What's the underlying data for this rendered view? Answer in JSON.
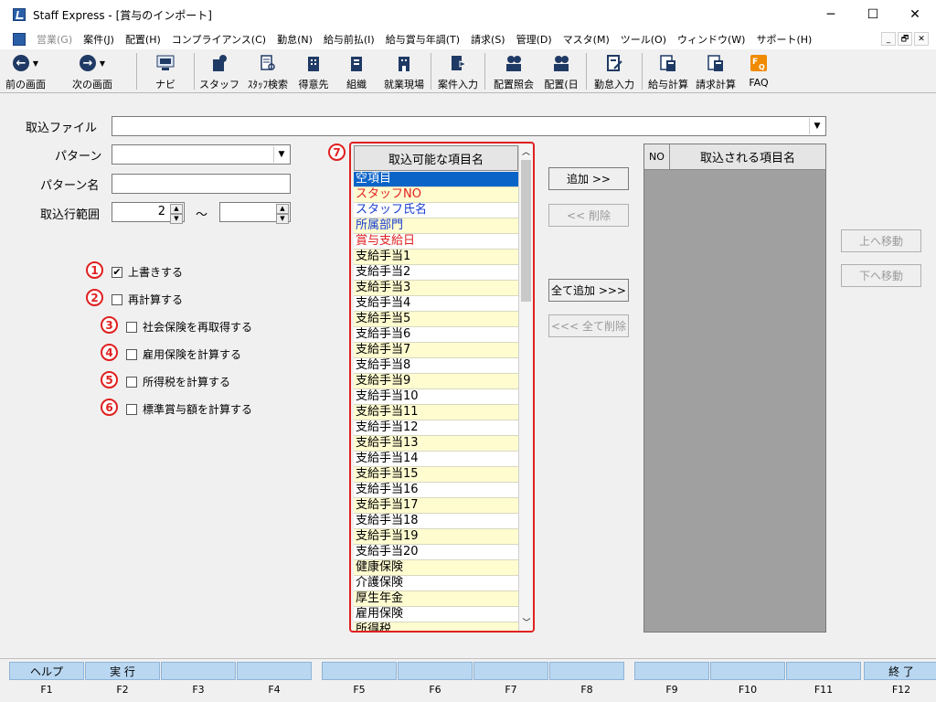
{
  "window": {
    "title": "Staff Express - [賞与のインポート]",
    "controls": [
      "─",
      "☐",
      "✕"
    ]
  },
  "menu": {
    "items": [
      {
        "label": "営業(G)",
        "disabled": true
      },
      {
        "label": "案件(J)",
        "disabled": false
      },
      {
        "label": "配置(H)",
        "disabled": false
      },
      {
        "label": "コンプライアンス(C)",
        "disabled": false
      },
      {
        "label": "勤怠(N)",
        "disabled": false
      },
      {
        "label": "給与前払(I)",
        "disabled": false
      },
      {
        "label": "給与賞与年調(T)",
        "disabled": false
      },
      {
        "label": "請求(S)",
        "disabled": false
      },
      {
        "label": "管理(D)",
        "disabled": false
      },
      {
        "label": "マスタ(M)",
        "disabled": false
      },
      {
        "label": "ツール(O)",
        "disabled": false
      },
      {
        "label": "ウィンドウ(W)",
        "disabled": false
      },
      {
        "label": "サポート(H)",
        "disabled": false
      }
    ],
    "mdi_controls": [
      "_",
      "🗗",
      "✕"
    ]
  },
  "toolbar": {
    "buttons": [
      {
        "label": "前の画面",
        "icon": "arrow-left-icon"
      },
      {
        "label": "次の画面",
        "icon": "arrow-right-icon"
      },
      {
        "label": "ナビ",
        "icon": "navi-icon"
      },
      {
        "label": "スタッフ",
        "icon": "staff-icon"
      },
      {
        "label": "ｽﾀｯﾌ検索",
        "icon": "staff-search-icon"
      },
      {
        "label": "得意先",
        "icon": "customer-icon"
      },
      {
        "label": "組織",
        "icon": "organization-icon"
      },
      {
        "label": "就業現場",
        "icon": "worksite-icon"
      },
      {
        "label": "案件入力",
        "icon": "project-entry-icon"
      },
      {
        "label": "配置照会",
        "icon": "assignment-inquiry-icon"
      },
      {
        "label": "配置(日",
        "icon": "assignment-daily-icon"
      },
      {
        "label": "勤怠入力",
        "icon": "attendance-entry-icon"
      },
      {
        "label": "給与計算",
        "icon": "payroll-calc-icon"
      },
      {
        "label": "請求計算",
        "icon": "billing-calc-icon"
      },
      {
        "label": "FAQ",
        "icon": "faq-icon"
      }
    ]
  },
  "form": {
    "import_file_label": "取込ファイル",
    "import_file_value": "",
    "pattern_label": "パターン",
    "pattern_value": "",
    "pattern_name_label": "パターン名",
    "pattern_name_value": "",
    "range_label": "取込行範囲",
    "range_from": "2",
    "range_tilde": "～",
    "range_to": ""
  },
  "options": [
    {
      "num": "1",
      "label": "上書きする",
      "checked": true
    },
    {
      "num": "2",
      "label": "再計算する",
      "checked": false
    },
    {
      "num": "3",
      "label": "社会保険を再取得する",
      "checked": false
    },
    {
      "num": "4",
      "label": "雇用保険を計算する",
      "checked": false
    },
    {
      "num": "5",
      "label": "所得税を計算する",
      "checked": false
    },
    {
      "num": "6",
      "label": "標準賞与額を計算する",
      "checked": false
    }
  ],
  "available": {
    "badge": "7",
    "header": "取込可能な項目名",
    "items": [
      {
        "text": "空項目",
        "color": "#ffffff",
        "bg": "selected"
      },
      {
        "text": "スタッフNO",
        "color": "#e02020",
        "bg": "yellow"
      },
      {
        "text": "スタッフ氏名",
        "color": "#1a3fcf",
        "bg": "white"
      },
      {
        "text": "所属部門",
        "color": "#1a3fcf",
        "bg": "yellow"
      },
      {
        "text": "賞与支給日",
        "color": "#e02020",
        "bg": "white"
      },
      {
        "text": "支給手当1",
        "color": "#000000",
        "bg": "yellow"
      },
      {
        "text": "支給手当2",
        "color": "#000000",
        "bg": "white"
      },
      {
        "text": "支給手当3",
        "color": "#000000",
        "bg": "yellow"
      },
      {
        "text": "支給手当4",
        "color": "#000000",
        "bg": "white"
      },
      {
        "text": "支給手当5",
        "color": "#000000",
        "bg": "yellow"
      },
      {
        "text": "支給手当6",
        "color": "#000000",
        "bg": "white"
      },
      {
        "text": "支給手当7",
        "color": "#000000",
        "bg": "yellow"
      },
      {
        "text": "支給手当8",
        "color": "#000000",
        "bg": "white"
      },
      {
        "text": "支給手当9",
        "color": "#000000",
        "bg": "yellow"
      },
      {
        "text": "支給手当10",
        "color": "#000000",
        "bg": "white"
      },
      {
        "text": "支給手当11",
        "color": "#000000",
        "bg": "yellow"
      },
      {
        "text": "支給手当12",
        "color": "#000000",
        "bg": "white"
      },
      {
        "text": "支給手当13",
        "color": "#000000",
        "bg": "yellow"
      },
      {
        "text": "支給手当14",
        "color": "#000000",
        "bg": "white"
      },
      {
        "text": "支給手当15",
        "color": "#000000",
        "bg": "yellow"
      },
      {
        "text": "支給手当16",
        "color": "#000000",
        "bg": "white"
      },
      {
        "text": "支給手当17",
        "color": "#000000",
        "bg": "yellow"
      },
      {
        "text": "支給手当18",
        "color": "#000000",
        "bg": "white"
      },
      {
        "text": "支給手当19",
        "color": "#000000",
        "bg": "yellow"
      },
      {
        "text": "支給手当20",
        "color": "#000000",
        "bg": "white"
      },
      {
        "text": "健康保険",
        "color": "#000000",
        "bg": "yellow"
      },
      {
        "text": "介護保険",
        "color": "#000000",
        "bg": "white"
      },
      {
        "text": "厚生年金",
        "color": "#000000",
        "bg": "yellow"
      },
      {
        "text": "雇用保険",
        "color": "#000000",
        "bg": "white"
      },
      {
        "text": "所得税",
        "color": "#000000",
        "bg": "yellow"
      }
    ]
  },
  "buttons": {
    "add": "追加 >>",
    "remove": "<< 削除",
    "add_all": "全て追加 >>>",
    "remove_all": "<<< 全て削除",
    "move_up": "上へ移動",
    "move_down": "下へ移動"
  },
  "imported": {
    "col_no": "NO",
    "col_name": "取込される項目名",
    "rows": []
  },
  "fkeys": [
    {
      "key": "F1",
      "label": "ヘルプ"
    },
    {
      "key": "F2",
      "label": "実 行"
    },
    {
      "key": "F3",
      "label": ""
    },
    {
      "key": "F4",
      "label": ""
    },
    {
      "key": "F5",
      "label": ""
    },
    {
      "key": "F6",
      "label": ""
    },
    {
      "key": "F7",
      "label": ""
    },
    {
      "key": "F8",
      "label": ""
    },
    {
      "key": "F9",
      "label": ""
    },
    {
      "key": "F10",
      "label": ""
    },
    {
      "key": "F11",
      "label": ""
    },
    {
      "key": "F12",
      "label": "終 了"
    }
  ]
}
